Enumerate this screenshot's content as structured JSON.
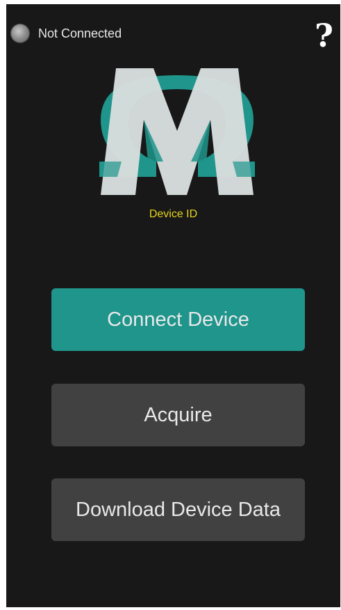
{
  "status": {
    "label": "Not Connected",
    "indicator_color": "#8d8d8d"
  },
  "help": {
    "label": "?"
  },
  "logo": {
    "icon": "omega-m-logo-icon",
    "colors": {
      "teal": "#1f958b",
      "light": "#d9dede"
    }
  },
  "device": {
    "id_label": "Device ID"
  },
  "buttons": {
    "connect": "Connect Device",
    "acquire": "Acquire",
    "download": "Download Device Data"
  },
  "theme": {
    "background": "#181818",
    "accent": "#1f958b",
    "button_secondary": "#414141",
    "device_id_color": "#e6d51a"
  }
}
